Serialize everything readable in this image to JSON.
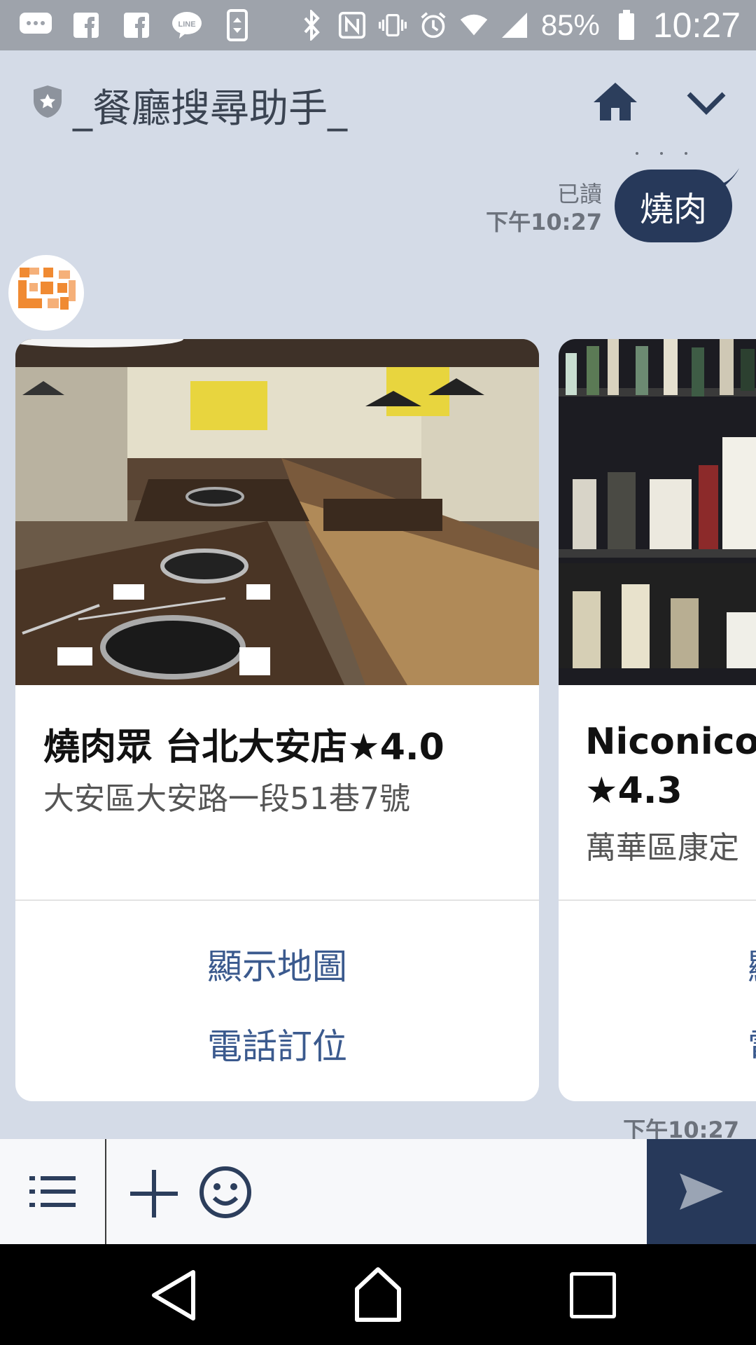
{
  "status_bar": {
    "battery": "85%",
    "time": "10:27",
    "left_icons": [
      "chat-dots-icon",
      "facebook-icon",
      "facebook-icon",
      "line-app-icon",
      "screen-rotate-icon"
    ],
    "right_icons": [
      "bluetooth-icon",
      "nfc-icon",
      "vibrate-icon",
      "alarm-icon",
      "wifi-icon",
      "cell-signal-icon",
      "battery-icon"
    ]
  },
  "header": {
    "title": "_餐廳搜尋助手_",
    "icons": [
      "shield-badge-icon",
      "home-icon",
      "chevron-down-icon"
    ]
  },
  "messages": {
    "sent": {
      "text": "燒肉",
      "read_label": "已讀",
      "time": "下午10:27"
    },
    "cards": [
      {
        "name": "燒肉眾 台北大安店★4.0",
        "address": "大安區大安路一段51巷7號",
        "actions": [
          "顯示地圖",
          "電話訂位"
        ]
      },
      {
        "name_line1": "Niconico Y",
        "name_line2": "★4.3",
        "address": "萬華區康定",
        "actions": [
          "顯",
          "電"
        ]
      }
    ],
    "received_time": "下午10:27"
  },
  "input_bar": {
    "icons": [
      "menu-list-icon",
      "plus-icon",
      "emoji-icon",
      "send-icon"
    ]
  },
  "nav_bar": {
    "icons": [
      "back-icon",
      "home-outline-icon",
      "recents-icon"
    ]
  },
  "colors": {
    "background": "#d4dbe7",
    "bubble": "#27395a",
    "link": "#3b5a8e",
    "status_bar": "#9ea3ab"
  }
}
